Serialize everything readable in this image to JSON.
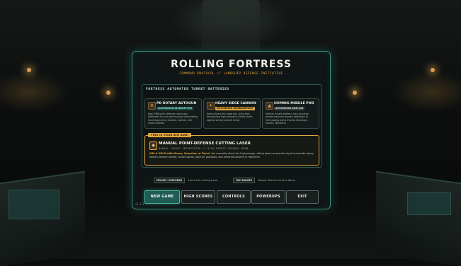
{
  "header": {
    "title": "ROLLING FORTRESS",
    "subtitle": "COMMAND PROTOCOL // LANDSHIP DEFENSE INITIATIVE"
  },
  "batteries": {
    "title": "FORTRESS AUTOMATED TURRET BATTERIES",
    "turrets": [
      {
        "name": "PD ROTARY AUTOGUN",
        "tag": "AUTOMATED INTERCEPTOR",
        "tag_color": "#5fc9b4",
        "desc": "High-RPM point-defense rotary gun. Dedicated to auto-tracking and intercepting incoming enemy missiles, rockets, and mortar bombs.",
        "icon": "autogun-icon"
      },
      {
        "name": "HEAVY SIEGE CANNON",
        "tag": "AUTOMATED BOMBARDMENT",
        "tag_color": "#e0a640",
        "desc": "Heavy direct-fire siege gun. Auto-fires devastating high-explosive kinetic shells against enemy ground armor.",
        "icon": "cannon-icon"
      },
      {
        "name": "HOMING MISSILE POD",
        "tag": "AUTOMATED ANTI-AIR",
        "tag_color": "#b8c2bd",
        "desc": "Vertical missile battery. Auto-launches guided warhead swarms dedicated to intercepting aerial threats (Gunships, Drones, Bombers).",
        "icon": "missile-icon"
      }
    ],
    "manual": {
      "badge": "THIS IS YOUR BIG GUN!",
      "name": "MANUAL POINT-DEFENSE CUTTING LASER",
      "subtitle": "MANUAL TARGET INTERCEPTOR // HIGH-ENERGY THERMAL BEAM",
      "desc_highlight": "AIM & HOLD with Mouse, Spacebar, or Touch:",
      "desc": "You manually direct the high-energy cutting beam across the sky to incinerate heavy stealth bomber bombs, rocket salvos, agile air gunships, and armored columns in real time!",
      "icon": "laser-icon"
    }
  },
  "hints": [
    {
      "key": "MOUSE / SPACEBAR",
      "label": "Aim & Fire Cutting Laser"
    },
    {
      "key": "TAP BADGES",
      "label": "Deploy Tactical Cards & Items"
    }
  ],
  "menu": {
    "new_game": "NEW GAME",
    "high_scores": "HIGH SCORES",
    "controls": "CONTROLS",
    "powerups": "POWERUPS",
    "exit": "EXIT"
  },
  "version": "v1.1.2",
  "colors": {
    "accent": "#46b5a2",
    "highlight": "#e0a640",
    "panel_border": "#3a8c7e"
  }
}
